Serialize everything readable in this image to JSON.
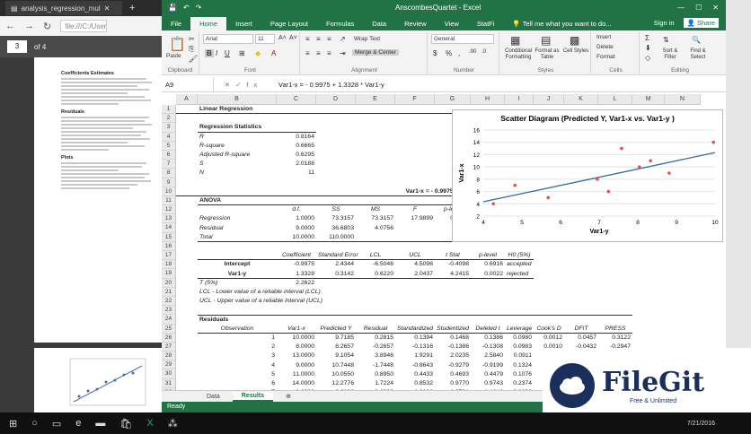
{
  "pdf": {
    "tab_title": "analysis_regression_mul",
    "url": "file:///C:/Users/",
    "page_current": "3",
    "page_of": "of 4",
    "sections": [
      "Coefficients Estimates",
      "Residuals",
      "Plots"
    ]
  },
  "excel": {
    "title": "AnscombesQuartet - Excel",
    "tabs": [
      "File",
      "Home",
      "Insert",
      "Page Layout",
      "Formulas",
      "Data",
      "Review",
      "View",
      "StatFi"
    ],
    "tell_me": "Tell me what you want to do...",
    "sign_in": "Sign in",
    "share": "Share",
    "ribbon": {
      "paste": "Paste",
      "clipboard": "Clipboard",
      "font_name": "Arial",
      "font_size": "11",
      "font_group": "Font",
      "wrap_text": "Wrap Text",
      "merge_center": "Merge & Center",
      "alignment": "Alignment",
      "number_format": "General",
      "number": "Number",
      "conditional": "Conditional Formatting",
      "format_table": "Format as Table",
      "cell_styles": "Cell Styles",
      "styles": "Styles",
      "insert": "Insert",
      "delete": "Delete",
      "format": "Format",
      "cells": "Cells",
      "sort_filter": "Sort & Filter",
      "find_select": "Find & Select",
      "editing": "Editing"
    },
    "name_box": "A9",
    "formula": "Var1-x = - 0.9975 + 1.3328 * Var1-y",
    "columns": [
      "A",
      "B",
      "C",
      "D",
      "E",
      "F",
      "G",
      "H",
      "I",
      "J",
      "K",
      "L",
      "M",
      "N"
    ],
    "rows": [
      "1",
      "2",
      "3",
      "4",
      "5",
      "6",
      "7",
      "8",
      "9",
      "10",
      "11",
      "12",
      "13",
      "14",
      "15",
      "16",
      "17",
      "18",
      "19",
      "20",
      "21",
      "22",
      "23",
      "24",
      "25",
      "26",
      "27",
      "28",
      "29",
      "30",
      "31",
      "32",
      "33",
      "34"
    ],
    "sheets": [
      "Data",
      "Results"
    ],
    "status": "Ready",
    "sheet": {
      "title": "Linear Regression",
      "reg_stats": "Regression Statistics",
      "stats": [
        [
          "R",
          "0.8164"
        ],
        [
          "R-square",
          "0.6665"
        ],
        [
          "Adjusted R-square",
          "0.6295"
        ],
        [
          "S",
          "2.0188"
        ],
        [
          "N",
          "11"
        ]
      ],
      "equation": "Var1-x = - 0.9975 + 1.3328 * Var1-y",
      "anova": "ANOVA",
      "anova_head": [
        "d.f.",
        "SS",
        "MS",
        "F",
        "p-level"
      ],
      "anova_rows": [
        [
          "Regression",
          "1.0000",
          "73.3157",
          "73.3157",
          "17.9899",
          "0.0022"
        ],
        [
          "Residual",
          "9.0000",
          "36.6803",
          "4.0756",
          "",
          ""
        ],
        [
          "Total",
          "10.0000",
          "110.0000",
          "",
          "",
          ""
        ]
      ],
      "coef_head": [
        "Coefficient",
        "Standard Error",
        "LCL",
        "UCL",
        "t Stat",
        "p-level",
        "H0 (5%)"
      ],
      "coef_rows": [
        [
          "Intercept",
          "-0.9975",
          "2.4344",
          "-6.5046",
          "4.5096",
          "-0.4098",
          "0.6916",
          "accepted"
        ],
        [
          "Var1-y",
          "1.3328",
          "0.3142",
          "0.6220",
          "2.0437",
          "4.2415",
          "0.0022",
          "rejected"
        ]
      ],
      "tval": "T (5%)",
      "tnum": "2.2622",
      "lcl_note": "LCL - Lower value of a reliable interval (LCL)",
      "ucl_note": "UCL - Upper value of a reliable interval (UCL)",
      "residuals": "Residuals",
      "res_head": [
        "Observation",
        "Var1-x",
        "Predicted Y",
        "Residual",
        "Standardized",
        "Studentized",
        "Deleted t",
        "Leverage",
        "Cook's D",
        "DFIT",
        "PRESS"
      ],
      "res_rows": [
        [
          "1",
          "10.0000",
          "9.7185",
          "0.2815",
          "0.1394",
          "0.1468",
          "0.1386",
          "0.0980",
          "0.0012",
          "0.0457",
          "0.3122"
        ],
        [
          "2",
          "8.0000",
          "8.2657",
          "-0.2657",
          "-0.1316",
          "-0.1386",
          "-0.1308",
          "0.0983",
          "0.0010",
          "-0.0432",
          "-0.2947"
        ],
        [
          "3",
          "13.0000",
          "9.1054",
          "3.8946",
          "1.9291",
          "2.0235",
          "2.5840",
          "0.0911",
          "0.2051",
          "0.8179",
          "4.2848"
        ],
        [
          "4",
          "9.0000",
          "10.7448",
          "-1.7448",
          "-0.8643",
          "-0.9279",
          "-0.9199",
          "0.1324",
          "0.0657",
          "-0.3594",
          "-2.0112"
        ],
        [
          "5",
          "11.0000",
          "10.0550",
          "0.8950",
          "0.4433",
          "0.4693",
          "0.4479",
          "0.1076",
          "0.0133",
          "",
          ""
        ],
        [
          "6",
          "14.0000",
          "12.2776",
          "1.7224",
          "0.8532",
          "0.9770",
          "0.9743",
          "0.2374",
          "0.1486",
          "",
          ""
        ],
        [
          "7",
          "6.0000",
          "8.6822",
          "-2.6822",
          "-1.3286",
          "-1.3791",
          "-1.4642",
          "0.0926",
          "0.0970",
          "",
          ""
        ],
        [
          "8",
          "4.0000",
          "4.6804",
          "-0.6804",
          "-0.3370",
          "-0.4166",
          "-0.3966",
          "0.3454",
          "0.0458",
          "",
          ""
        ]
      ]
    }
  },
  "chart_data": {
    "type": "scatter",
    "title": "Scatter Diagram (Predicted Y, Var1-x vs. Var1-y )",
    "xlabel": "Var1-y",
    "ylabel": "Var1-x",
    "xlim": [
      4,
      10
    ],
    "ylim": [
      2,
      16
    ],
    "xticks": [
      4,
      5,
      6,
      7,
      8,
      9,
      10
    ],
    "yticks": [
      2,
      4,
      6,
      8,
      10,
      12,
      14,
      16
    ],
    "series": [
      {
        "name": "",
        "type": "scatter",
        "color": "#e05050",
        "x": [
          8.04,
          6.95,
          7.58,
          8.81,
          8.33,
          9.96,
          7.24,
          4.26,
          10.84,
          4.82,
          5.68
        ],
        "y": [
          10,
          8,
          13,
          9,
          11,
          14,
          6,
          4,
          12,
          7,
          5
        ]
      },
      {
        "name": "",
        "type": "line",
        "color": "#2e6fa8",
        "x": [
          4,
          10
        ],
        "y": [
          4.33,
          12.33
        ]
      }
    ]
  },
  "filegit": {
    "name": "FileGit",
    "tagline": "Free & Unlimited"
  },
  "taskbar": {
    "date": "7/21/2016"
  }
}
